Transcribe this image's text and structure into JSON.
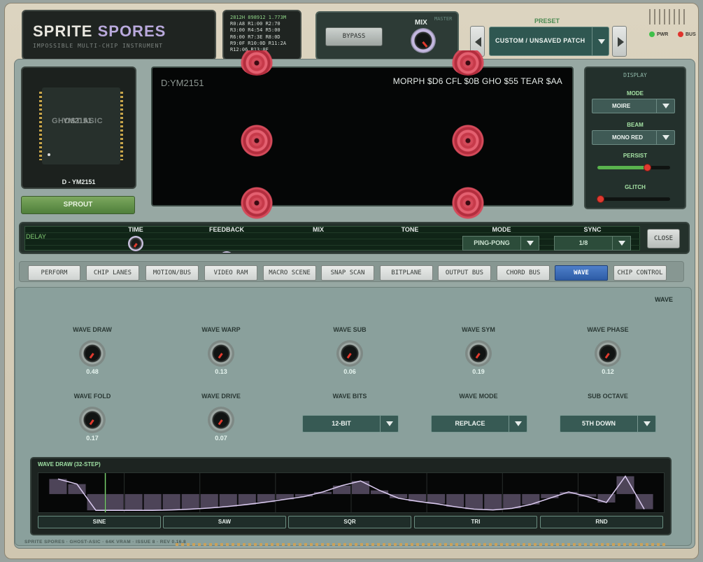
{
  "brand": {
    "title_a": "SPRITE",
    "title_b": "SPORES",
    "subtitle": "IMPOSSIBLE MULTI-CHIP INSTRUMENT"
  },
  "registers": {
    "header": "2812H 898912 1.773M",
    "lines": [
      "R0:A8 R1:00 R2:70",
      "R3:00 R4:54 R5:00",
      "R6:00 R7:3E R8:0D",
      "R9:0F R10:0D R11:2A",
      "R12:06 R13:0F"
    ]
  },
  "master": {
    "bypass_label": "BYPASS",
    "mix_label": "MIX",
    "master_label": "MASTER"
  },
  "preset": {
    "label": "PRESET",
    "value": "CUSTOM / UNSAVED PATCH"
  },
  "status": {
    "pwr_label": "PWR",
    "bus_label": "BUS",
    "pwr_color": "#3fc04a",
    "bus_color": "#e0332c"
  },
  "chip": {
    "die_text": "GHOST ASIC",
    "overlay_text": "YM2151",
    "label": "D - YM2151",
    "sprout_label": "SPROUT"
  },
  "scope": {
    "source": "D:YM2151",
    "params": "MORPH $D6  CFL $0B  GHO $55  TEAR $AA",
    "beam_color": "#d44a5a"
  },
  "display": {
    "title": "DISPLAY",
    "mode_label": "MODE",
    "mode_value": "MOIRE",
    "beam_label": "BEAM",
    "beam_value": "MONO RED",
    "persist_label": "PERSIST",
    "persist_value": 0.68,
    "glitch_label": "GLITCH",
    "glitch_value": 0.04
  },
  "delay": {
    "name": "DELAY",
    "time_label": "TIME",
    "feedback_label": "FEEDBACK",
    "mix_label": "MIX",
    "tone_label": "TONE",
    "mode_label": "MODE",
    "mode_value": "PING-PONG",
    "sync_label": "SYNC",
    "sync_value": "1/8",
    "close_label": "CLOSE"
  },
  "tabs": [
    {
      "label": "PERFORM",
      "active": false
    },
    {
      "label": "CHIP LANES",
      "active": false
    },
    {
      "label": "MOTION/BUS",
      "active": false
    },
    {
      "label": "VIDEO RAM",
      "active": false
    },
    {
      "label": "MACRO SCENE",
      "active": false
    },
    {
      "label": "SNAP SCAN",
      "active": false
    },
    {
      "label": "BITPLANE",
      "active": false
    },
    {
      "label": "OUTPUT BUS",
      "active": false
    },
    {
      "label": "CHORD BUS",
      "active": false
    },
    {
      "label": "WAVE",
      "active": true
    },
    {
      "label": "CHIP CONTROL",
      "active": false
    }
  ],
  "wave": {
    "title": "WAVE",
    "knobs": [
      {
        "label": "WAVE DRAW",
        "value": "0.48"
      },
      {
        "label": "WAVE WARP",
        "value": "0.13"
      },
      {
        "label": "WAVE SUB",
        "value": "0.06"
      },
      {
        "label": "WAVE SYM",
        "value": "0.19"
      },
      {
        "label": "WAVE PHASE",
        "value": "0.12"
      },
      {
        "label": "WAVE FOLD",
        "value": "0.17"
      },
      {
        "label": "WAVE DRIVE",
        "value": "0.07"
      }
    ],
    "selects": [
      {
        "label": "WAVE BITS",
        "value": "12-BIT"
      },
      {
        "label": "WAVE MODE",
        "value": "REPLACE"
      },
      {
        "label": "SUB OCTAVE",
        "value": "5TH DOWN"
      }
    ],
    "draw_title": "WAVE DRAW  (32-STEP)",
    "steps": [
      0.85,
      0.72,
      0.05,
      0.05,
      0.05,
      0.05,
      0.06,
      0.08,
      0.11,
      0.15,
      0.2,
      0.26,
      0.33,
      0.4,
      0.52,
      0.68,
      0.8,
      0.56,
      0.36,
      0.28,
      0.22,
      0.14,
      0.08,
      0.06,
      0.1,
      0.2,
      0.36,
      0.52,
      0.4,
      0.25,
      0.92,
      0.08
    ],
    "playhead_step": 3,
    "buttons": [
      "SINE",
      "SAW",
      "SQR",
      "TRI",
      "RND"
    ]
  },
  "footer": "SPRITE SPORES · GHOST-ASIC · 64K VRAM · ISSUE 8 · REV 0.16.8"
}
